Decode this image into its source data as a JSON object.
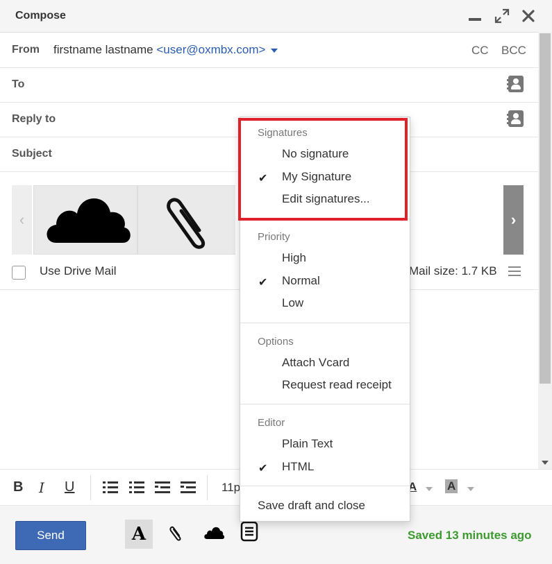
{
  "window": {
    "title": "Compose"
  },
  "from": {
    "label": "From",
    "name": "firstname lastname",
    "email": "<user@oxmbx.com>",
    "cc": "CC",
    "bcc": "BCC"
  },
  "to": {
    "label": "To"
  },
  "reply_to": {
    "label": "Reply to"
  },
  "subject": {
    "label": "Subject"
  },
  "attachments": {
    "use_drive_mail": "Use Drive Mail",
    "mail_size": "Mail size: 1.7 KB"
  },
  "toolbar": {
    "bold": "B",
    "italic": "I",
    "underline": "U",
    "font_size": "11p",
    "text_color": "A",
    "bg_color": "A"
  },
  "footer": {
    "send": "Send",
    "format_icon": "A",
    "saved_status": "Saved 13 minutes ago"
  },
  "menu": {
    "signatures": {
      "title": "Signatures",
      "items": [
        {
          "label": "No signature",
          "checked": false
        },
        {
          "label": "My Signature",
          "checked": true
        },
        {
          "label": "Edit signatures...",
          "checked": false
        }
      ]
    },
    "priority": {
      "title": "Priority",
      "items": [
        {
          "label": "High",
          "checked": false
        },
        {
          "label": "Normal",
          "checked": true
        },
        {
          "label": "Low",
          "checked": false
        }
      ]
    },
    "options": {
      "title": "Options",
      "items": [
        {
          "label": "Attach Vcard",
          "checked": false
        },
        {
          "label": "Request read receipt",
          "checked": false
        }
      ]
    },
    "editor": {
      "title": "Editor",
      "items": [
        {
          "label": "Plain Text",
          "checked": false
        },
        {
          "label": "HTML",
          "checked": true
        }
      ]
    },
    "save_draft": "Save draft and close",
    "check_glyph": "✔"
  },
  "icons": {
    "minimize": "minimize-icon",
    "expand": "expand-icon",
    "close": "close-icon",
    "address_book": "address-book-icon",
    "cloud": "cloud-icon",
    "paperclip": "paperclip-icon"
  },
  "colors": {
    "send_button": "#3d69b5",
    "saved_text": "#3c9a2e",
    "highlight_box": "#e0202a",
    "email_link": "#2a5db0"
  }
}
